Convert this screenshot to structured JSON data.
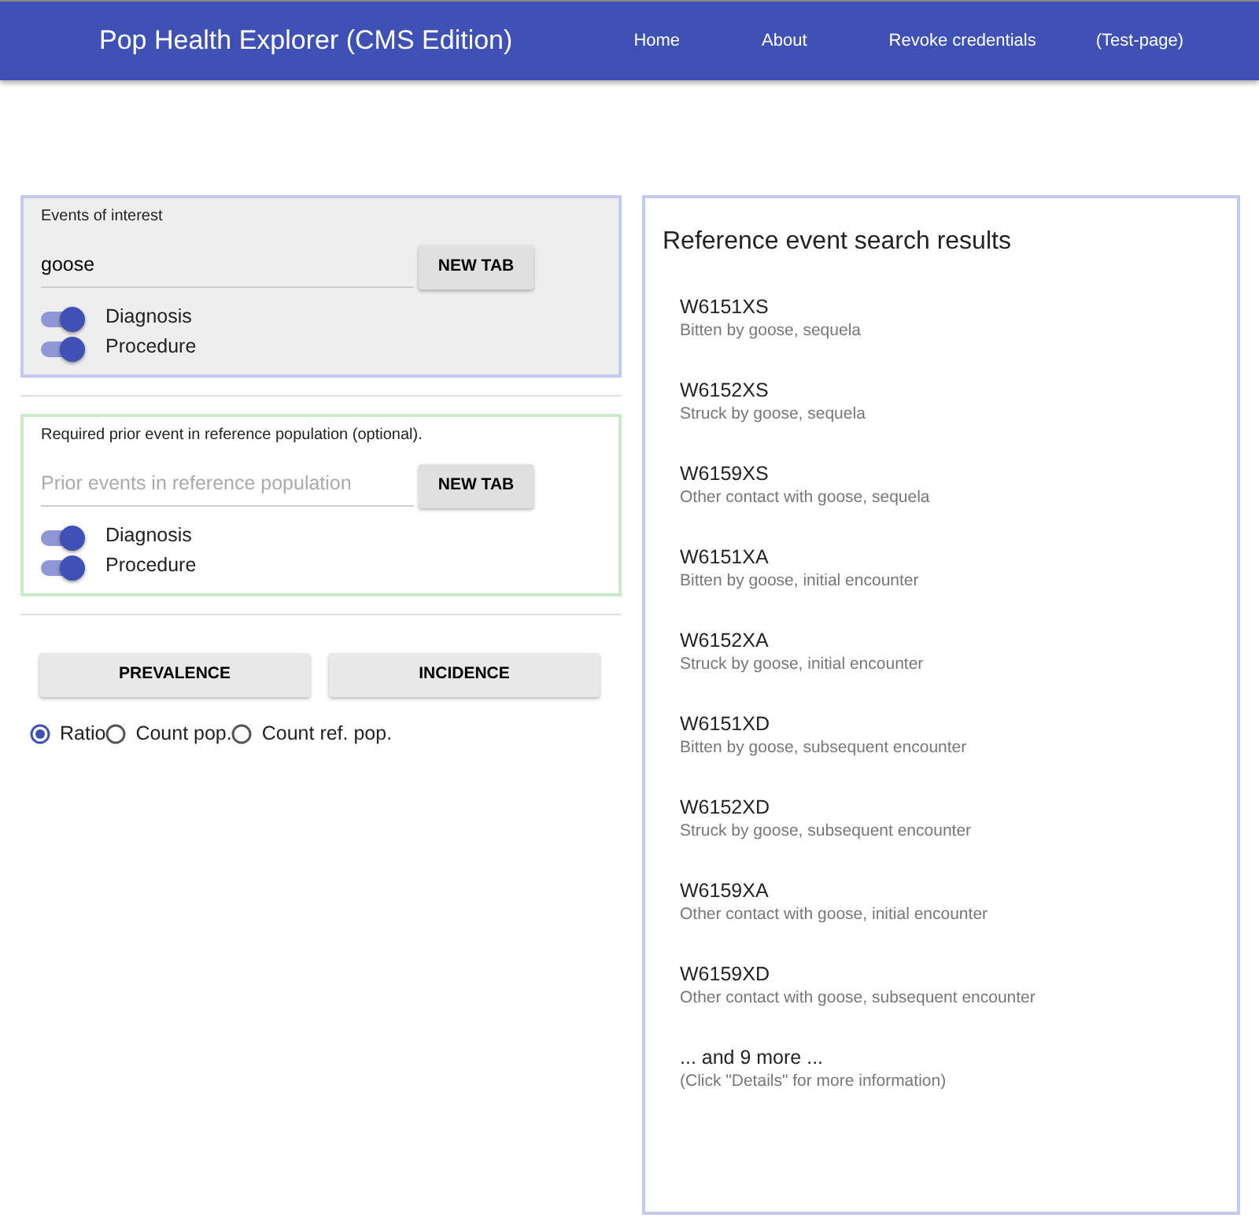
{
  "navbar": {
    "title": "Pop Health Explorer (CMS Edition)",
    "links": [
      "Home",
      "About",
      "Revoke credentials",
      "(Test-page)"
    ]
  },
  "events_panel": {
    "label": "Events of interest",
    "value": "goose",
    "button": "NEW TAB",
    "toggles": [
      {
        "label": "Diagnosis",
        "on": true
      },
      {
        "label": "Procedure",
        "on": true
      }
    ]
  },
  "prior_panel": {
    "label": "Required prior event in reference population (optional).",
    "placeholder": "Prior events in reference population",
    "button": "NEW TAB",
    "toggles": [
      {
        "label": "Diagnosis",
        "on": true
      },
      {
        "label": "Procedure",
        "on": true
      }
    ]
  },
  "actions": [
    "PREVALENCE",
    "INCIDENCE"
  ],
  "measures": [
    {
      "label": "Ratio",
      "selected": true
    },
    {
      "label": "Count pop.",
      "selected": false
    },
    {
      "label": "Count ref. pop.",
      "selected": false
    }
  ],
  "results": {
    "title": "Reference event search results",
    "items": [
      {
        "code": "W6151XS",
        "description": "Bitten by goose, sequela"
      },
      {
        "code": "W6152XS",
        "description": "Struck by goose, sequela"
      },
      {
        "code": "W6159XS",
        "description": "Other contact with goose, sequela"
      },
      {
        "code": "W6151XA",
        "description": "Bitten by goose, initial encounter"
      },
      {
        "code": "W6152XA",
        "description": "Struck by goose, initial encounter"
      },
      {
        "code": "W6151XD",
        "description": "Bitten by goose, subsequent encounter"
      },
      {
        "code": "W6152XD",
        "description": "Struck by goose, subsequent encounter"
      },
      {
        "code": "W6159XA",
        "description": "Other contact with goose, initial encounter"
      },
      {
        "code": "W6159XD",
        "description": "Other contact with goose, subsequent encounter"
      }
    ],
    "more": {
      "code": "... and 9 more ...",
      "description": "(Click \"Details\" for more information)"
    }
  }
}
